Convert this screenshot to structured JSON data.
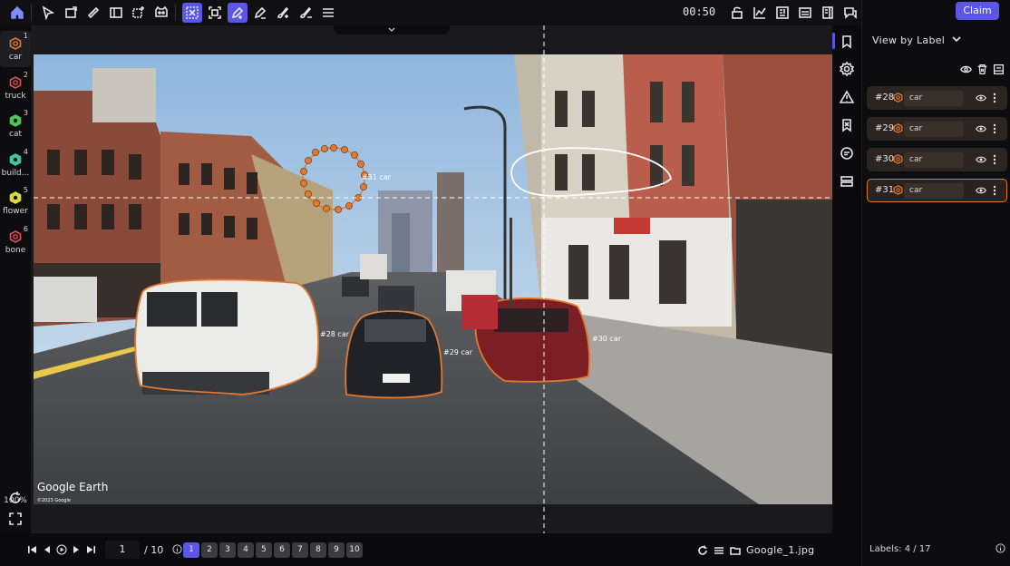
{
  "toolbar": {
    "timer": "00:50",
    "tools": [
      "home-icon",
      "pointer-icon",
      "rectangle-icon",
      "ruler-icon",
      "panel-icon",
      "add-box-icon",
      "cat-face-icon",
      "smart-select-icon",
      "box-select-icon",
      "pen-plus-icon",
      "pen-minus-icon",
      "brush-plus-icon",
      "brush-minus-icon",
      "menu-icon"
    ],
    "active_tools": [
      "smart-select-icon",
      "pen-plus-icon"
    ]
  },
  "classes": [
    {
      "num": "1",
      "name": "car",
      "color": "#e07a2e",
      "selected": true
    },
    {
      "num": "2",
      "name": "truck",
      "color": "#e05050",
      "selected": false
    },
    {
      "num": "3",
      "name": "cat",
      "color": "#4fc35b",
      "selected": false
    },
    {
      "num": "4",
      "name": "build...",
      "color": "#3fc6a8",
      "selected": false
    },
    {
      "num": "5",
      "name": "flower",
      "color": "#d9dc3a",
      "selected": false
    },
    {
      "num": "6",
      "name": "bone",
      "color": "#e05050",
      "selected": false
    }
  ],
  "zoom": "100%",
  "canvas": {
    "collapse_icon": "chevron-down-icon",
    "watermark": "Google Earth",
    "watermark_small": "©2023 Google",
    "annotations": [
      {
        "id": "#31",
        "label": "#31 car"
      },
      {
        "id": "#28",
        "label": "#28 car"
      },
      {
        "id": "#29",
        "label": "#29 car"
      },
      {
        "id": "#30",
        "label": "#30 car"
      }
    ]
  },
  "right_panel": {
    "claim_label": "Claim",
    "view_by_label": "View by Label",
    "labels": [
      {
        "id": "#28",
        "name": "car",
        "selected": false
      },
      {
        "id": "#29",
        "name": "car",
        "selected": false
      },
      {
        "id": "#30",
        "name": "car",
        "selected": false
      },
      {
        "id": "#31",
        "name": "car",
        "selected": true
      }
    ],
    "labels_count": "Labels: 4 / 17"
  },
  "bottom": {
    "current_page": "1",
    "total_pages": "/ 10",
    "pages": [
      "1",
      "2",
      "3",
      "4",
      "5",
      "6",
      "7",
      "8",
      "9",
      "10"
    ],
    "active_page": "1",
    "file_name": "Google_1.jpg"
  },
  "colors": {
    "accent": "#5b55e8",
    "car": "#e07a2e"
  }
}
